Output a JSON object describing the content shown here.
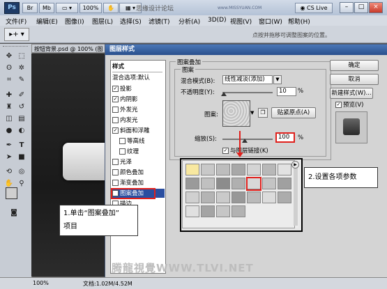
{
  "window": {
    "app_logo": "Ps",
    "site_banner": "思缘设计论坛",
    "site_url": "www.MISSYUAN.COM",
    "workspace": "CS Live",
    "btn_bridge": "Br",
    "btn_mini": "Mb",
    "zoom": "100%",
    "min": "–",
    "max": "□",
    "close": "×"
  },
  "menu": [
    "文件(F)",
    "编辑(E)",
    "图像(I)",
    "图层(L)",
    "选择(S)",
    "滤镜(T)",
    "分析(A)",
    "3D(D)",
    "视图(V)",
    "窗口(W)",
    "帮助(H)"
  ],
  "options": {
    "tool": "▸+ ▾",
    "hint": "点按并拖移可调整图案的位置。"
  },
  "document": {
    "tab_title": "按钮背景.psd @ 100% (图",
    "zoom": "100%",
    "doc_size": "文档:1.02M/4.52M"
  },
  "dialog": {
    "title": "图层样式",
    "styles_header": "样式",
    "blend_default": "混合选项:默认",
    "styles": [
      {
        "label": "投影",
        "checked": true
      },
      {
        "label": "内阴影",
        "checked": true
      },
      {
        "label": "外发光",
        "checked": false
      },
      {
        "label": "内发光",
        "checked": false
      },
      {
        "label": "斜面和浮雕",
        "checked": true
      },
      {
        "label": "等高线",
        "checked": false
      },
      {
        "label": "纹理",
        "checked": false
      },
      {
        "label": "光泽",
        "checked": false
      },
      {
        "label": "颜色叠加",
        "checked": false
      },
      {
        "label": "渐变叠加",
        "checked": false
      },
      {
        "label": "图案叠加",
        "checked": true
      },
      {
        "label": "描边",
        "checked": false
      }
    ],
    "group_title": "图案叠加",
    "subgroup_title": "图案",
    "blend_mode_label": "混合模式(B):",
    "blend_mode_value": "线性减淡(添加)",
    "opacity_label": "不透明度(Y):",
    "opacity_value": "10",
    "pct": "%",
    "pattern_label": "图案:",
    "snap_origin": "贴紧原点(A)",
    "scale_label": "缩放(S):",
    "scale_value": "100",
    "link_label": "与图层链接(K)",
    "link_checked": true,
    "btn_ok": "确定",
    "btn_cancel": "取消",
    "btn_new_style": "新建样式(W)...",
    "preview_label": "预览(V)",
    "preview_checked": true
  },
  "annotations": {
    "step1_line1": "1.单击“图案叠加”",
    "step1_line2": "项目",
    "step2": "2.设置各项参数"
  },
  "watermark": "腾龍視覺WWW.TLVI.NET"
}
